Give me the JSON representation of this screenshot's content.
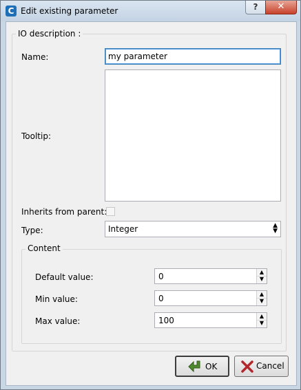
{
  "window": {
    "app_icon_letter": "C",
    "title": "Edit existing parameter",
    "help_label": "?",
    "close_label": "✕"
  },
  "io_description": {
    "legend": "IO description :",
    "name_label": "Name:",
    "name_value": "my parameter",
    "tooltip_label": "Tooltip:",
    "tooltip_value": "",
    "inherits_label": "Inherits from parent:",
    "inherits_checked": false,
    "type_label": "Type:",
    "type_value": "Integer"
  },
  "content": {
    "legend": "Content",
    "default_label": "Default value:",
    "default_value": "0",
    "min_label": "Min value:",
    "min_value": "0",
    "max_label": "Max value:",
    "max_value": "100"
  },
  "buttons": {
    "ok_label": "OK",
    "cancel_label": "Cancel"
  },
  "colors": {
    "ok_icon": "#4f8a2e",
    "cancel_icon": "#b3262b"
  }
}
